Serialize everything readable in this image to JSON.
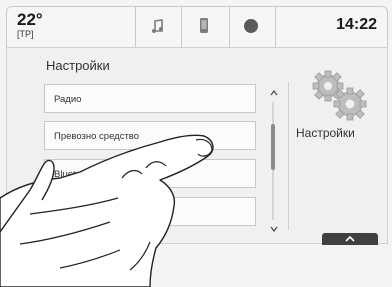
{
  "status_bar": {
    "temperature": "22°",
    "temperature_mode": "[TP]",
    "time": "14:22",
    "tabs": [
      {
        "icon": "music-note-icon"
      },
      {
        "icon": "phone-icon"
      },
      {
        "icon": "circle-icon"
      }
    ]
  },
  "menu": {
    "title": "Настройки",
    "items": [
      {
        "label": "Радио"
      },
      {
        "label": "Превозно средство"
      },
      {
        "label": "Bluetooth"
      },
      {
        "label": ""
      }
    ]
  },
  "side_panel": {
    "icon": "gears-icon",
    "caption": "Настройки"
  },
  "colors": {
    "background": "#f4f4f4",
    "bottom_tab": "#3f3f3f"
  }
}
